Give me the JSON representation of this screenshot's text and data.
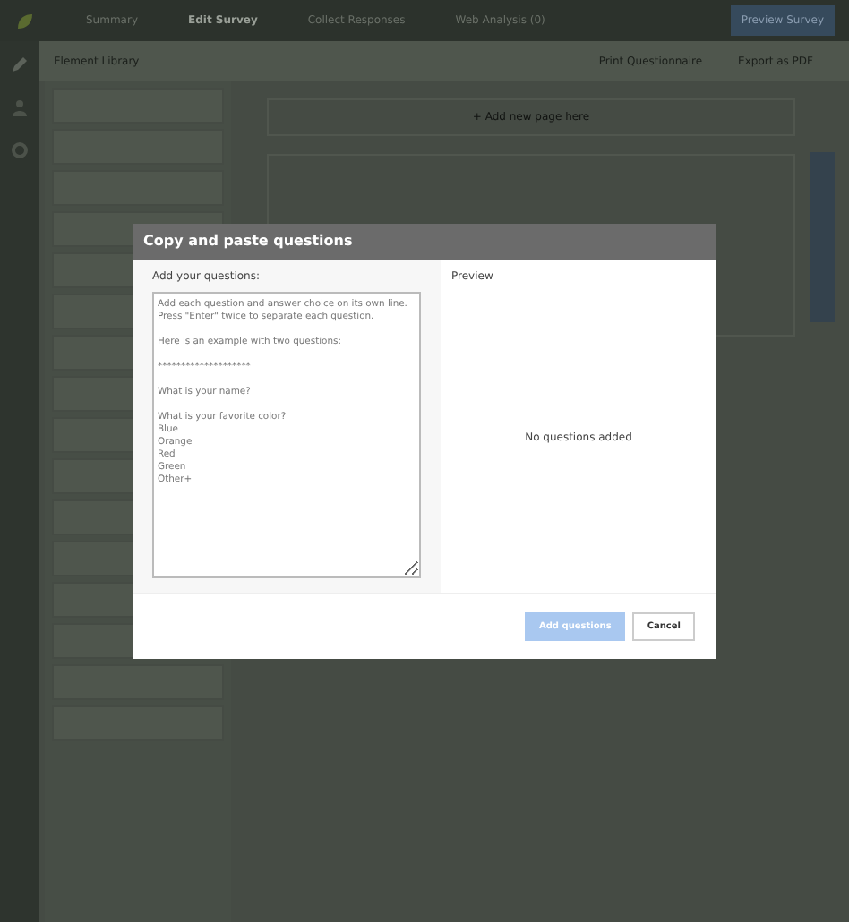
{
  "top_bar": {
    "items": [
      {
        "label": "Summary",
        "selected": false
      },
      {
        "label": "Edit Survey",
        "selected": true
      },
      {
        "label": "Collect Responses",
        "selected": false
      },
      {
        "label": "Web Analysis (0)",
        "selected": false
      }
    ],
    "preview_button": "Preview Survey"
  },
  "toolbar": {
    "title": "Element Library",
    "print": "Print Questionnaire",
    "export": "Export as PDF"
  },
  "canvas": {
    "add_page": "+ Add new page here"
  },
  "dialog": {
    "title": "Copy and paste questions",
    "input_label": "Add your questions:",
    "placeholder": "Add each question and answer choice on its own line.\nPress \"Enter\" twice to separate each question.\n\nHere is an example with two questions:\n\n********************\n\nWhat is your name?\n\nWhat is your favorite color?\nBlue\nOrange\nRed\nGreen\nOther+",
    "preview_label": "Preview",
    "empty_text": "No questions added",
    "primary_button": {
      "label": "Add questions",
      "disabled": true
    },
    "cancel_button": "Cancel"
  }
}
